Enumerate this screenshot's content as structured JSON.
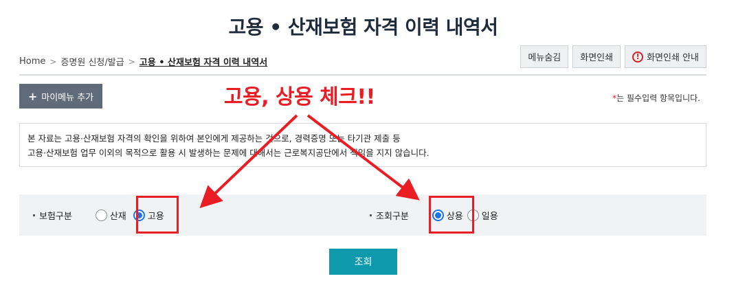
{
  "page": {
    "title": "고용 • 산재보험 자격 이력 내역서"
  },
  "breadcrumb": {
    "items": [
      "Home",
      "증명원 신청/발급",
      "고용 • 산재보험 자격 이력 내역서"
    ]
  },
  "top_buttons": {
    "hide_menu": "메뉴숨김",
    "print_screen": "화면인쇄",
    "print_guide": "화면인쇄 안내",
    "print_guide_icon": "!"
  },
  "mymenu": {
    "plus": "+",
    "label": "마이메뉴 추가"
  },
  "required_note": {
    "star": "*",
    "text": "는 필수입력 항목입니다."
  },
  "annotation": {
    "text": "고용, 상용 체크!!",
    "color": "#ea1c24"
  },
  "notice": {
    "line1": "본 자료는 고용·산재보험 자격의 확인을 위하여 본인에게 제공하는 것으로, 경력증명 또는 타기관 제출 등",
    "line2": "고용·산재보험 업무 이외의 목적으로 활용 시 발생하는 문제에 대해서는 근로복지공단에서 책임을 지지 않습니다."
  },
  "filters": {
    "insurance_type": {
      "label": "보험구분",
      "options": [
        {
          "label": "산재",
          "checked": false
        },
        {
          "label": "고용",
          "checked": true
        }
      ]
    },
    "query_type": {
      "label": "조회구분",
      "options": [
        {
          "label": "상용",
          "checked": true
        },
        {
          "label": "일용",
          "checked": false
        }
      ]
    }
  },
  "search_button": {
    "label": "조회",
    "color": "#0e9aac"
  }
}
